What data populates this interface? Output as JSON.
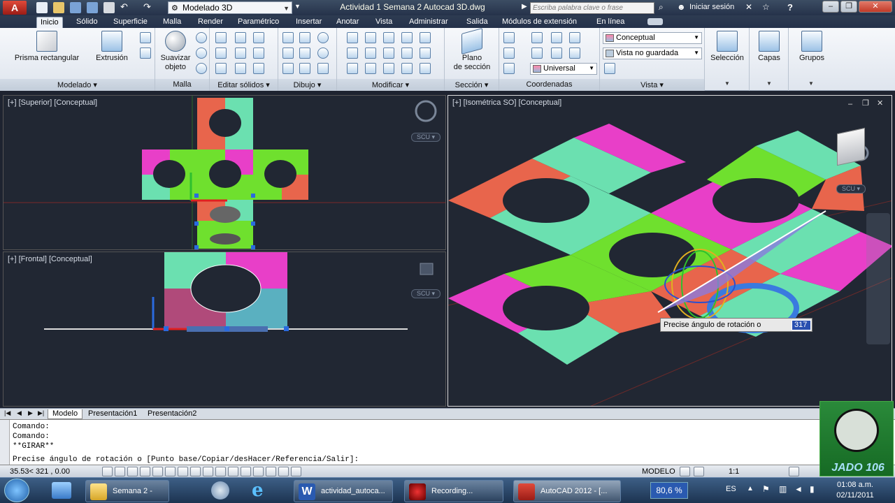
{
  "titlebar": {
    "workspace": "Modelado 3D",
    "document_title": "Actividad 1 Semana 2 Autocad 3D.dwg",
    "search_placeholder": "Escriba palabra clave o frase",
    "signin": "Iniciar sesión",
    "help": "?"
  },
  "tabs": [
    "Inicio",
    "Sólido",
    "Superficie",
    "Malla",
    "Render",
    "Paramétrico",
    "Insertar",
    "Anotar",
    "Vista",
    "Administrar",
    "Salida",
    "Módulos de extensión",
    "En línea"
  ],
  "ribbon": {
    "prisma": "Prisma rectangular",
    "extrusion": "Extrusión",
    "suavizar_1": "Suavizar",
    "suavizar_2": "objeto",
    "plano_1": "Plano",
    "plano_2": "de sección",
    "visual_style": "Conceptual",
    "view_state": "Vista no guardada",
    "ucs": "Universal",
    "seleccion": "Selección",
    "capas": "Capas",
    "grupos": "Grupos",
    "panels": [
      "Modelado",
      "Malla",
      "Editar sólidos",
      "Dibujo",
      "Modificar",
      "Sección",
      "Coordenadas",
      "Vista"
    ]
  },
  "viewports": {
    "top_label": "[+] [Superior] [Conceptual]",
    "front_label": "[+] [Frontal] [Conceptual]",
    "iso_label": "[+] [Isométrica SO] [Conceptual]",
    "scu": "SCU",
    "tooltip": "Precise ángulo de rotación o",
    "tooltip_value": "317"
  },
  "layout_tabs": [
    "Modelo",
    "Presentación1",
    "Presentación2"
  ],
  "command": {
    "lines": [
      "Comando:",
      "Comando:",
      "**GIRAR**"
    ],
    "prompt": "Precise ángulo de rotación o [Punto base/Copiar/desHacer/Referencia/Salir]:"
  },
  "status": {
    "coords": "35.53< 321 , 0.00",
    "modelo": "MODELO",
    "scale": "1:1"
  },
  "logo_text": "JADO 106",
  "taskbar": {
    "items": [
      "Semana 2 -",
      "actividad_autoca...",
      "Recording...",
      "AutoCAD 2012 - [..."
    ],
    "zoom": "80,6 %",
    "lang": "ES",
    "time": "01:08 a.m.",
    "date": "02/11/2011"
  },
  "colors": {
    "accent": "#c0302c",
    "green": "#6fe02e",
    "magenta": "#e83fc8",
    "salmon": "#e8654c",
    "mint": "#6be0b0"
  }
}
